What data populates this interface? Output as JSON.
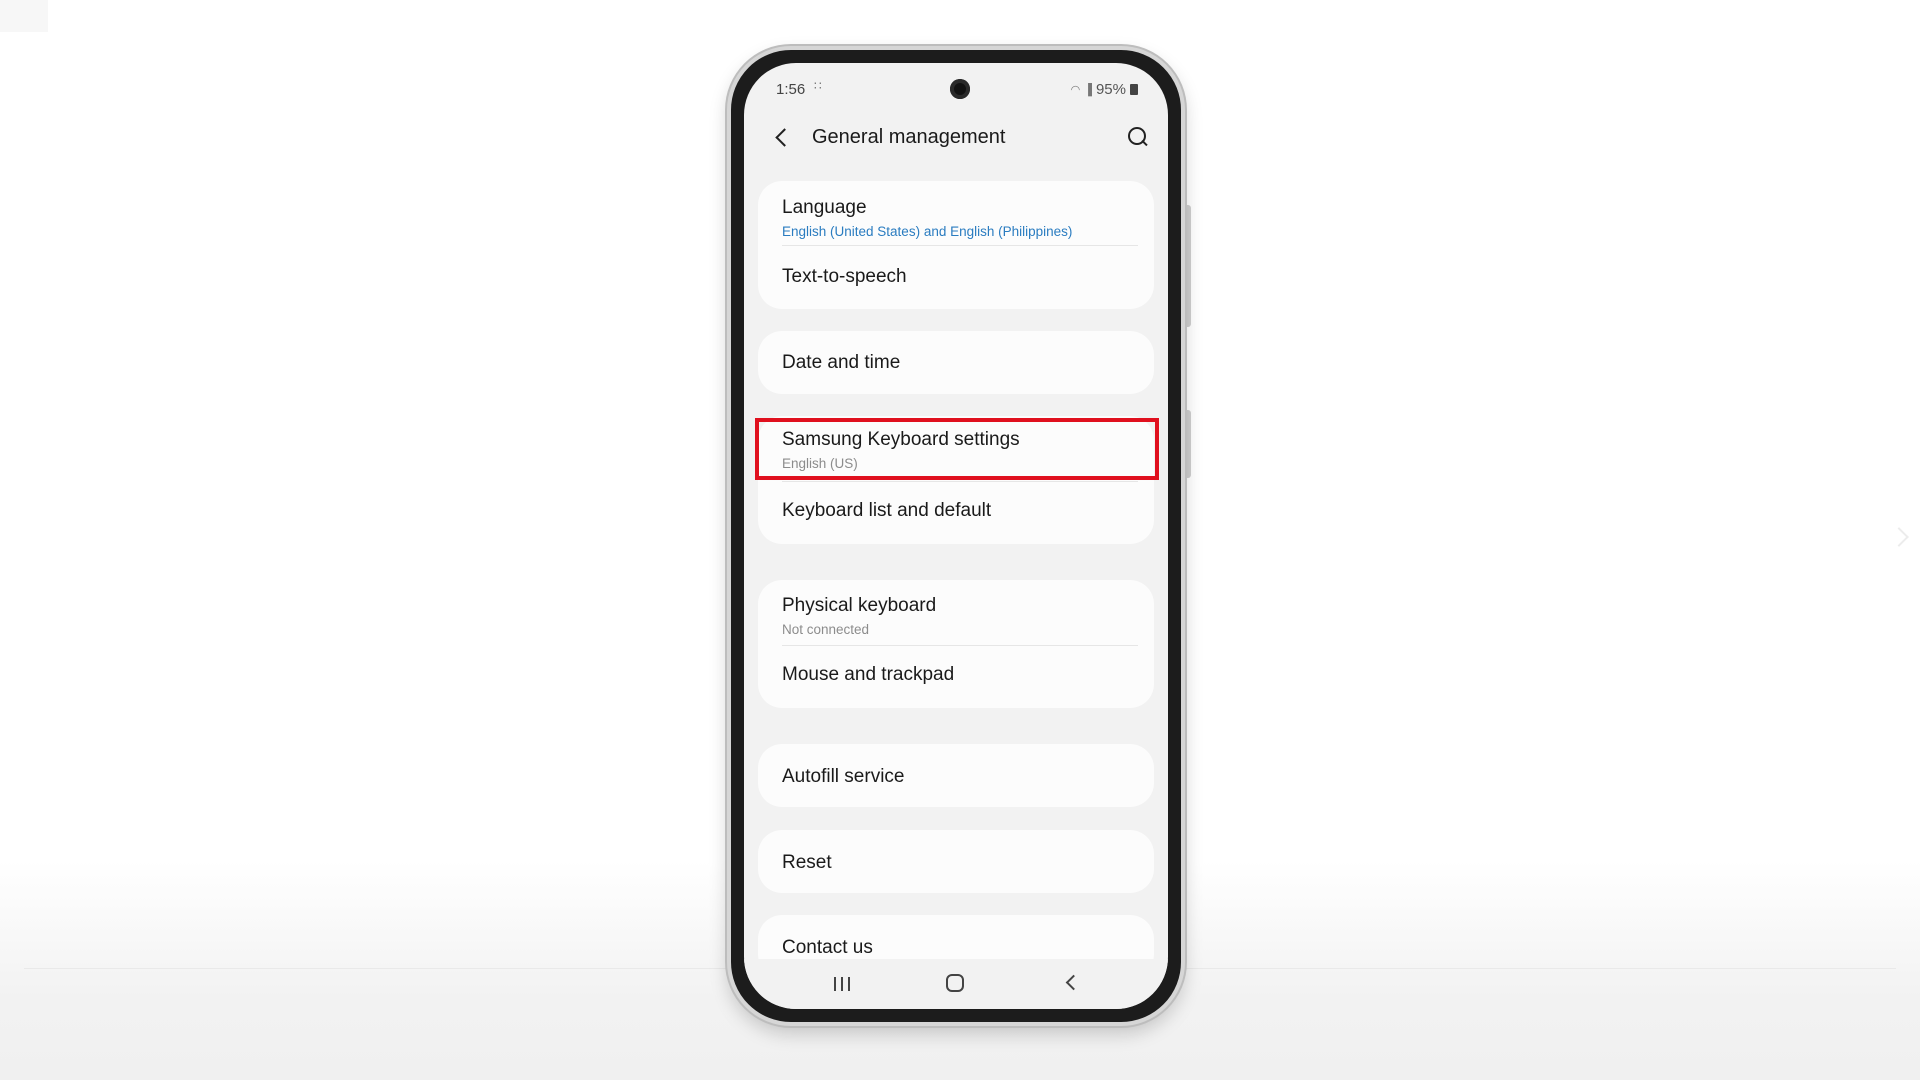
{
  "status_bar": {
    "time": "1:56",
    "notif_dots": "∷",
    "battery_percent": "95%"
  },
  "header": {
    "title": "General management"
  },
  "menu": {
    "language": {
      "label": "Language",
      "sub": "English (United States) and English (Philippines)"
    },
    "text_to_speech": {
      "label": "Text-to-speech"
    },
    "date_time": {
      "label": "Date and time"
    },
    "samsung_keyboard": {
      "label": "Samsung Keyboard settings",
      "sub": "English (US)"
    },
    "keyboard_list": {
      "label": "Keyboard list and default"
    },
    "physical_keyboard": {
      "label": "Physical keyboard",
      "sub": "Not connected"
    },
    "mouse_trackpad": {
      "label": "Mouse and trackpad"
    },
    "autofill": {
      "label": "Autofill service"
    },
    "reset": {
      "label": "Reset"
    },
    "contact_us": {
      "label": "Contact us"
    }
  },
  "colors": {
    "highlight": "#e0101e",
    "subtext_blue": "#2a7cc0"
  },
  "icons": [
    "back-icon",
    "search-icon",
    "recents-icon",
    "home-icon",
    "nav-back-icon",
    "battery-icon",
    "wifi-icon",
    "signal-icon"
  ]
}
